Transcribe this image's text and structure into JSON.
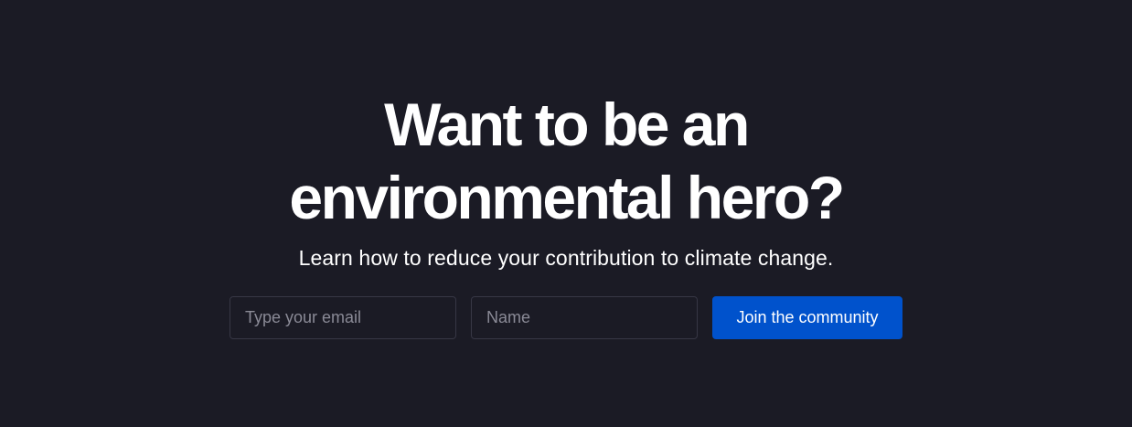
{
  "hero": {
    "headline_line1": "Want to be an",
    "headline_line2": "environmental hero?",
    "subtitle": "Learn how to reduce your contribution to climate change."
  },
  "form": {
    "email_placeholder": "Type your email",
    "email_value": "",
    "name_placeholder": "Name",
    "name_value": "",
    "submit_label": "Join the community"
  },
  "colors": {
    "background": "#1b1b25",
    "text": "#ffffff",
    "input_border": "#373745",
    "placeholder": "#8a8a96",
    "accent": "#0052cc"
  }
}
